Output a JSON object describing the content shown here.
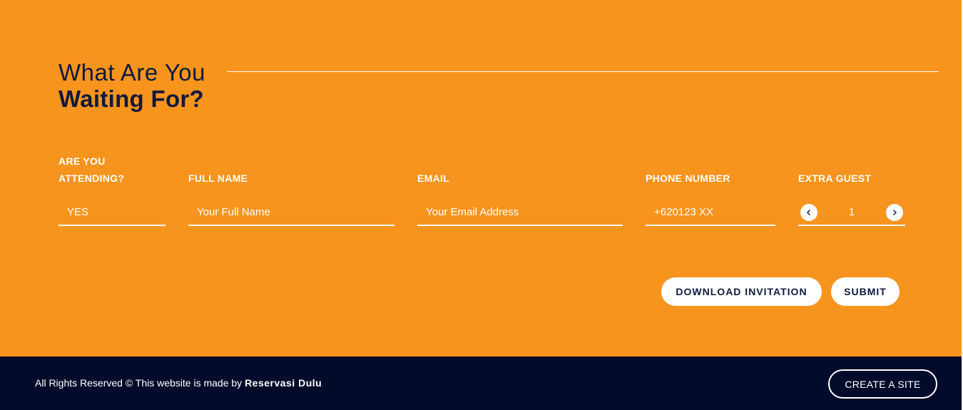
{
  "colors": {
    "background": "#F7941E",
    "heading": "#0D1A3D",
    "footer": "#020C2A",
    "text_light": "#ffffff"
  },
  "headline": {
    "line1": "What Are You",
    "line2": "Waiting For?"
  },
  "form": {
    "attending": {
      "label": "ARE YOU ATTENDING?",
      "value": "YES"
    },
    "full_name": {
      "label": "FULL NAME",
      "placeholder": "Your Full Name"
    },
    "email": {
      "label": "EMAIL",
      "placeholder": "Your Email Address"
    },
    "phone": {
      "label": "PHONE NUMBER",
      "placeholder": "+620123 XX"
    },
    "extra_guest": {
      "label": "EXTRA GUEST",
      "value": "1",
      "decrement_icon": "chevron-left-icon",
      "increment_icon": "chevron-right-icon"
    }
  },
  "actions": {
    "download_label": "DOWNLOAD INVITATION",
    "submit_label": "SUBMIT"
  },
  "footer": {
    "copyright_text": "All Rights Reserved © This website is made by",
    "brand": "Reservasi Dulu",
    "create_site_label": "CREATE A SITE"
  }
}
